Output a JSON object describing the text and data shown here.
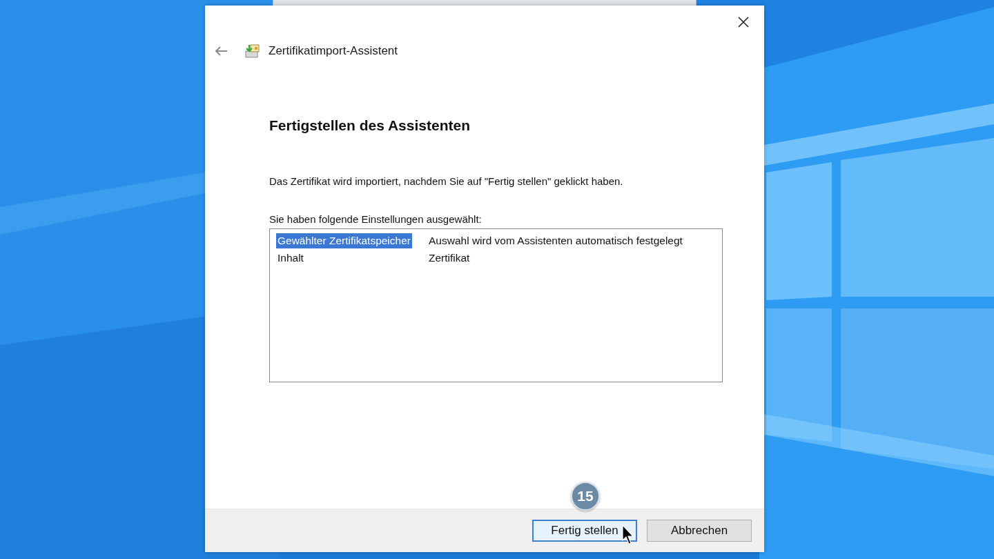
{
  "window": {
    "title": "Zertifikatimport-Assistent"
  },
  "heading": "Fertigstellen des Assistenten",
  "description": "Das Zertifikat wird importiert, nachdem Sie auf \"Fertig stellen\" geklickt haben.",
  "settings": {
    "label": "Sie haben folgende Einstellungen ausgewählt:",
    "rows": [
      {
        "name": "Gewählter Zertifikatspeicher",
        "value": "Auswahl wird vom Assistenten automatisch festgelegt",
        "selected": true
      },
      {
        "name": "Inhalt",
        "value": "Zertifikat",
        "selected": false
      }
    ]
  },
  "buttons": [
    {
      "label": "Fertig stellen",
      "default": true
    },
    {
      "label": "Abbrechen",
      "default": false
    }
  ],
  "step_badge": "15"
}
